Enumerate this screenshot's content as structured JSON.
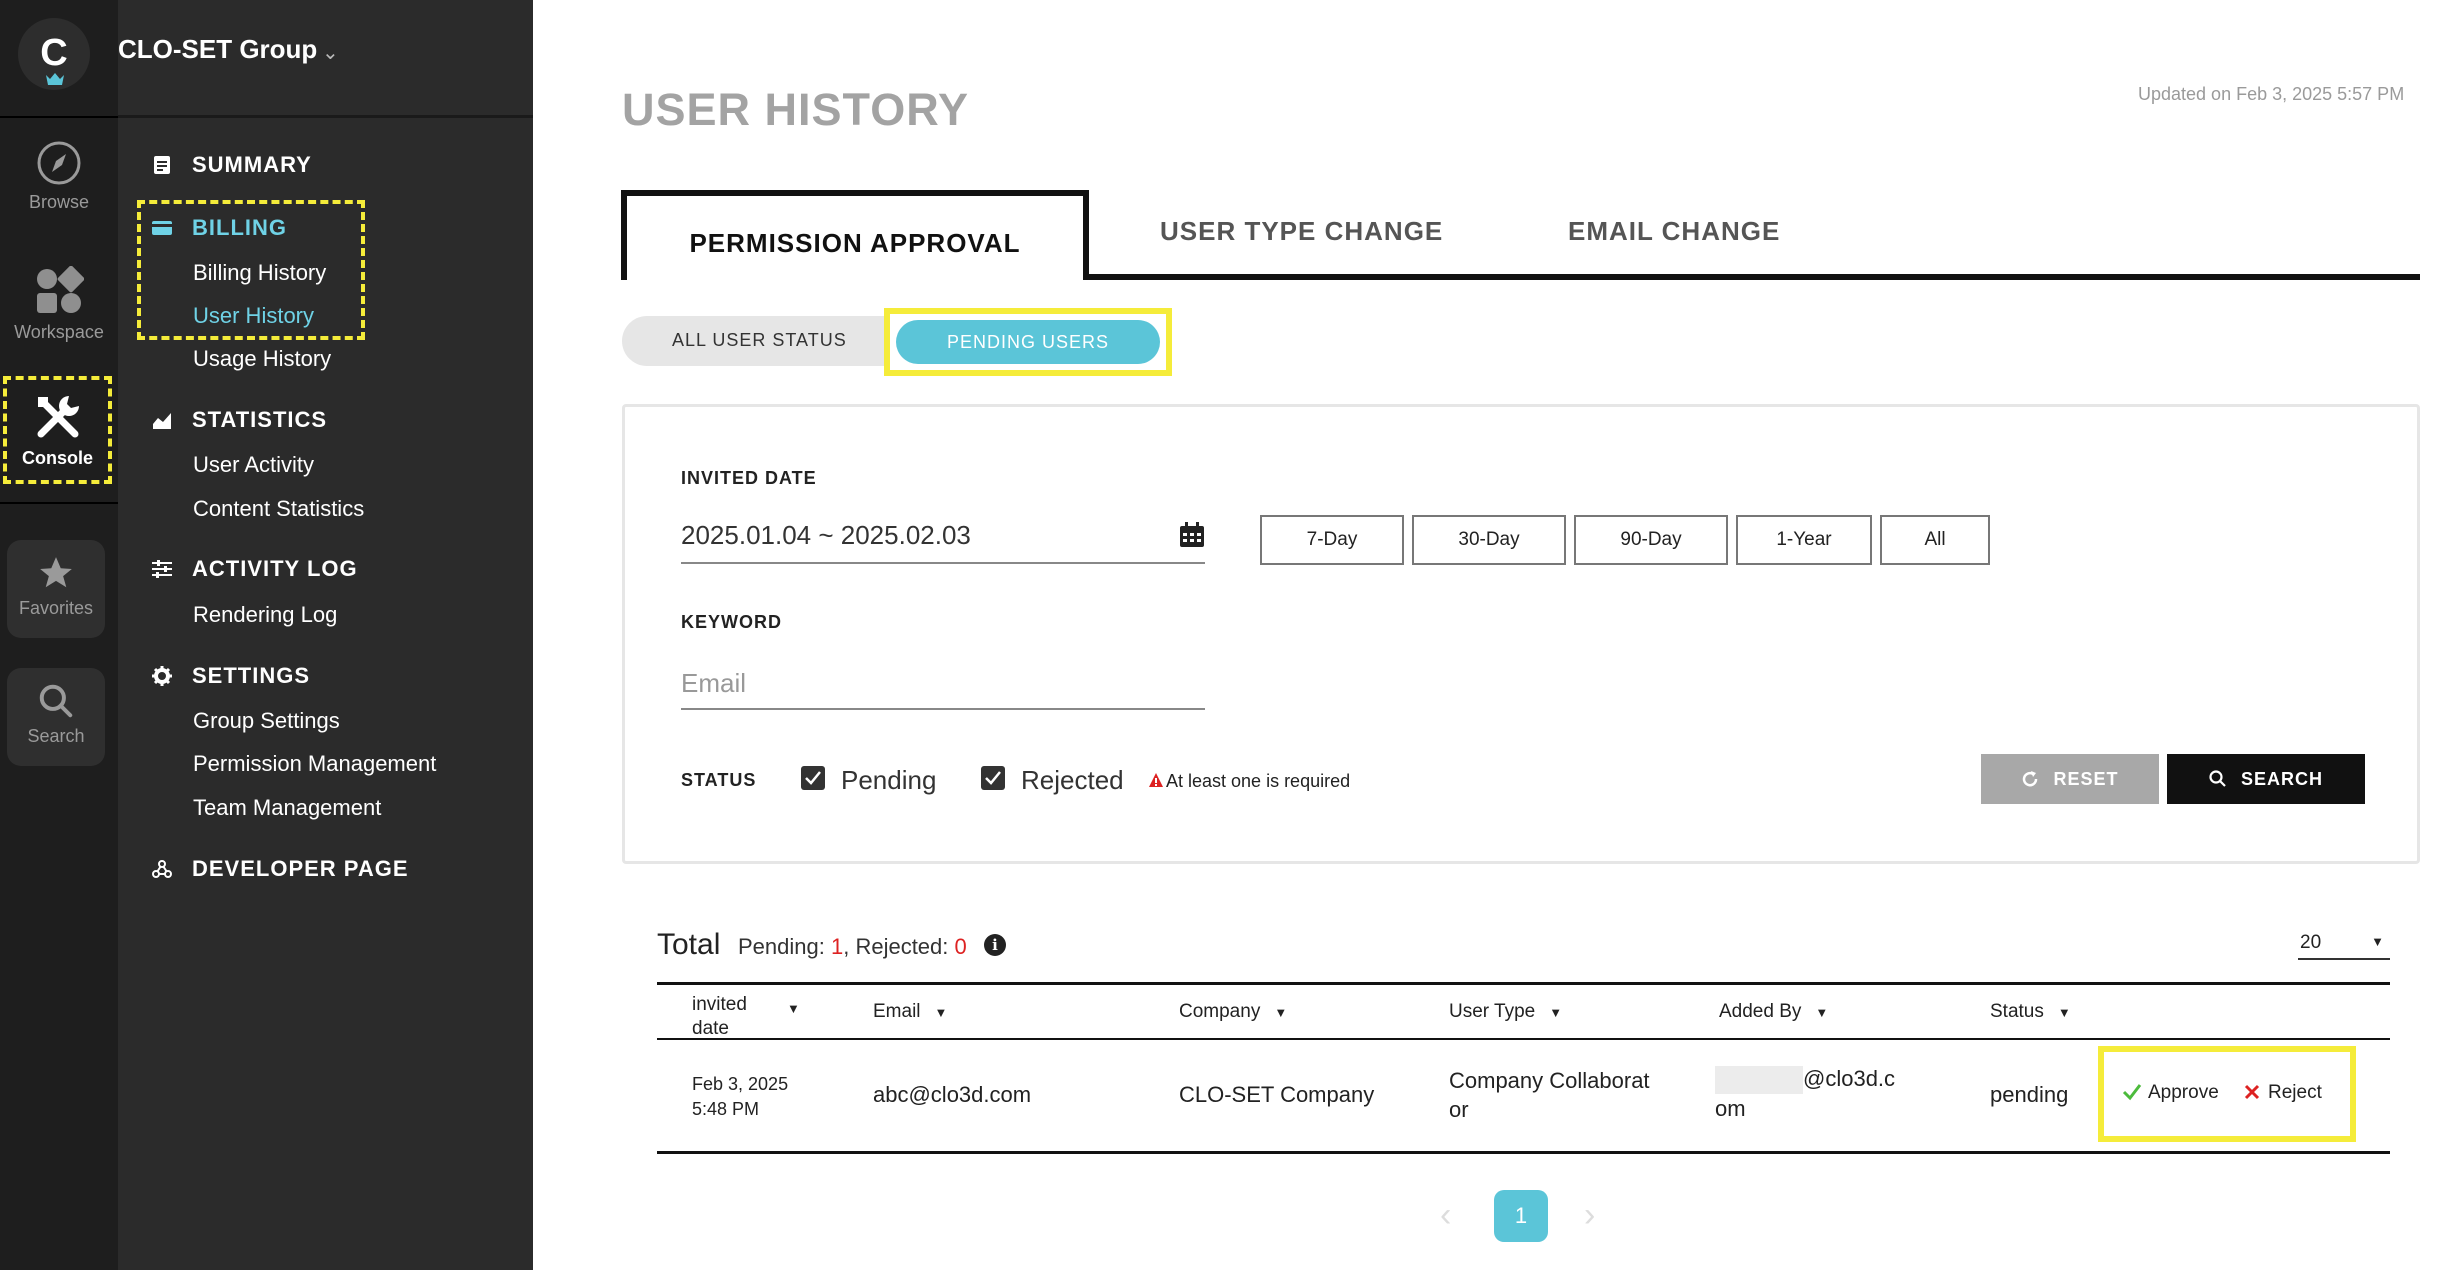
{
  "rail": {
    "logo_letter": "C",
    "items": {
      "browse": "Browse",
      "workspace": "Workspace",
      "console": "Console",
      "favorites": "Favorites",
      "search": "Search"
    }
  },
  "sidebar": {
    "group_name": "CLO-SET Group",
    "summary": "SUMMARY",
    "billing": "BILLING",
    "billing_history": "Billing History",
    "user_history": "User History",
    "usage_history": "Usage History",
    "statistics": "STATISTICS",
    "user_activity": "User Activity",
    "content_statistics": "Content Statistics",
    "activity_log": "ACTIVITY LOG",
    "rendering_log": "Rendering Log",
    "settings": "SETTINGS",
    "group_settings": "Group Settings",
    "permission_management": "Permission Management",
    "team_management": "Team Management",
    "developer_page": "DEVELOPER PAGE"
  },
  "header": {
    "title": "USER HISTORY",
    "updated": "Updated on Feb 3, 2025 5:57 PM"
  },
  "tabs": {
    "permission_approval": "PERMISSION APPROVAL",
    "user_type_change": "USER TYPE CHANGE",
    "email_change": "EMAIL CHANGE"
  },
  "toggle": {
    "all": "ALL USER STATUS",
    "pending": "PENDING USERS"
  },
  "filter": {
    "invited_date_label": "INVITED DATE",
    "date_range": "2025.01.04 ~ 2025.02.03",
    "ranges": [
      "7-Day",
      "30-Day",
      "90-Day",
      "1-Year",
      "All"
    ],
    "keyword_label": "KEYWORD",
    "keyword_placeholder": "Email",
    "status_label": "STATUS",
    "status_pending": "Pending",
    "status_rejected": "Rejected",
    "warning": "At least one is required",
    "reset": "RESET",
    "search": "SEARCH"
  },
  "summary": {
    "total": "Total",
    "pending_label": "Pending: ",
    "pending_count": "1",
    "rejected_label": ", Rejected: ",
    "rejected_count": "0",
    "page_size": "20"
  },
  "table": {
    "headers": {
      "invited_date_1": "invited",
      "invited_date_2": "date",
      "email": "Email",
      "company": "Company",
      "user_type": "User Type",
      "added_by": "Added By",
      "status": "Status"
    },
    "rows": [
      {
        "date_1": "Feb 3, 2025",
        "date_2": "5:48 PM",
        "email": "abc@clo3d.com",
        "company": "CLO-SET Company",
        "user_type_1": "Company Collaborat",
        "user_type_2": "or",
        "added_by_1": "@clo3d.c",
        "added_by_2": "om",
        "status": "pending",
        "approve": "Approve",
        "reject": "Reject"
      }
    ]
  },
  "pagination": {
    "current": "1"
  },
  "colors": {
    "accent": "#5bc5d8",
    "highlight": "#f5ec3a",
    "sidebar_active": "#6fd2e6"
  }
}
